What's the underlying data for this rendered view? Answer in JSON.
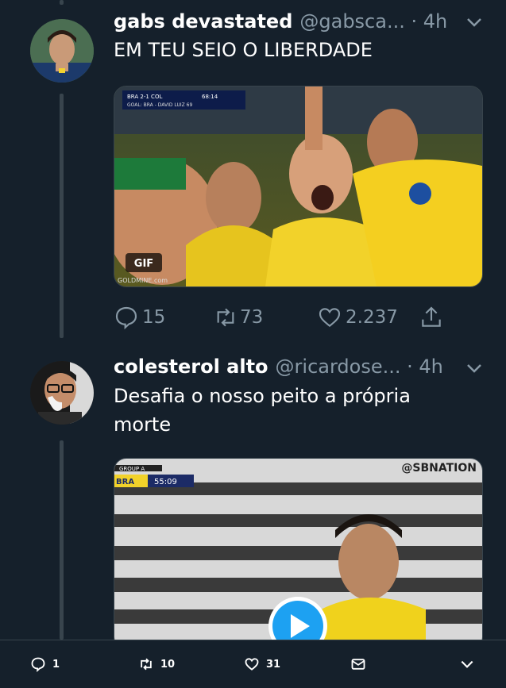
{
  "tweet1": {
    "name": "gabs devastated",
    "handle": "@gabsca... · 4h",
    "text": "EM TEU SEIO O LIBERDADE",
    "media_badge": "GIF",
    "media_credit": "GOLDMINE.com",
    "scoreboard": {
      "teams": "BRA 2-1 COL",
      "time": "68:14",
      "scorer": "GOAL: BRA - DAVID LUIZ 69"
    },
    "actions": {
      "replies": "15",
      "retweets": "73",
      "likes": "2.237"
    }
  },
  "tweet2": {
    "name": "colesterol alto",
    "handle": "@ricardose... · 4h",
    "text": "Desafia o nosso peito a própria morte",
    "media_overlay": {
      "group": "GROUP A",
      "team": "BRA",
      "clock": "55:09",
      "network": "@SBNATION"
    }
  },
  "bottom_bar": {
    "replies": "1",
    "retweets": "10",
    "likes": "31"
  },
  "colors": {
    "background": "#15202b",
    "muted": "#8899a6",
    "line": "#38444d",
    "play": "#1da1f2"
  }
}
